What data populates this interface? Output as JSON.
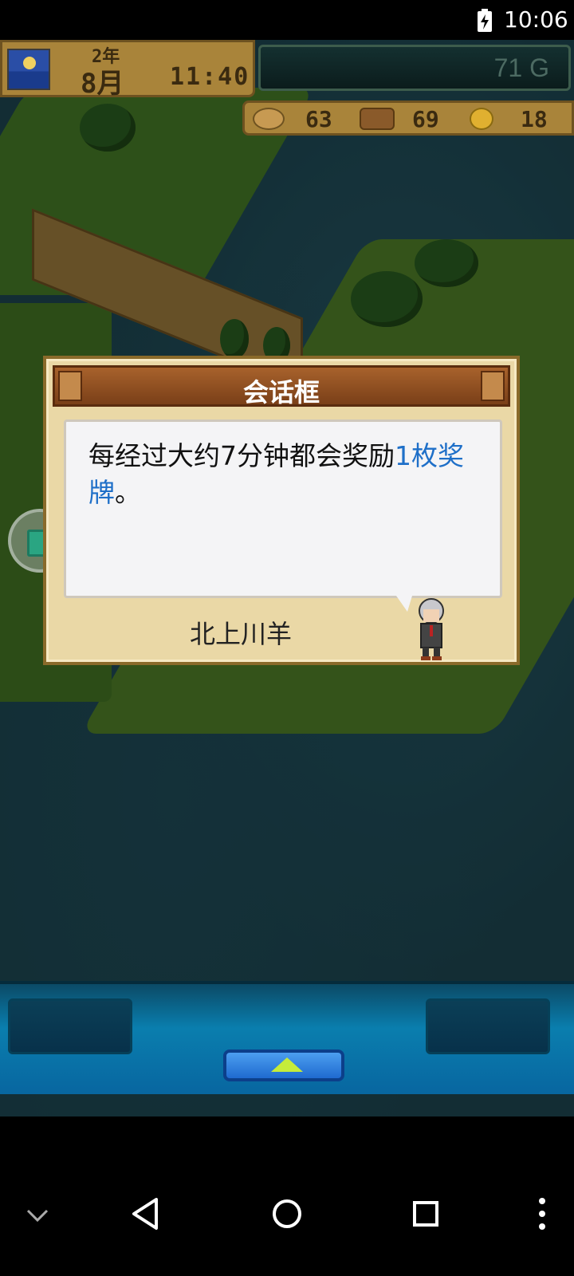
{
  "status_bar": {
    "time": "10:06"
  },
  "hud": {
    "year": "2年",
    "month": "8月",
    "clock": "11:40",
    "money": "71 G",
    "resources": [
      {
        "icon": "food-icon",
        "value": "63"
      },
      {
        "icon": "wood-icon",
        "value": "69"
      },
      {
        "icon": "medal-icon",
        "value": "18"
      }
    ]
  },
  "dialog": {
    "title": "会话框",
    "message_plain": "每经过大约7分钟都会奖励",
    "message_highlight": "1枚奖牌",
    "message_end": "。",
    "speaker": "北上川羊"
  },
  "colors": {
    "highlight": "#1e6fc8",
    "dialog_header": "#7a3f18",
    "panel": "#0a7eae"
  }
}
